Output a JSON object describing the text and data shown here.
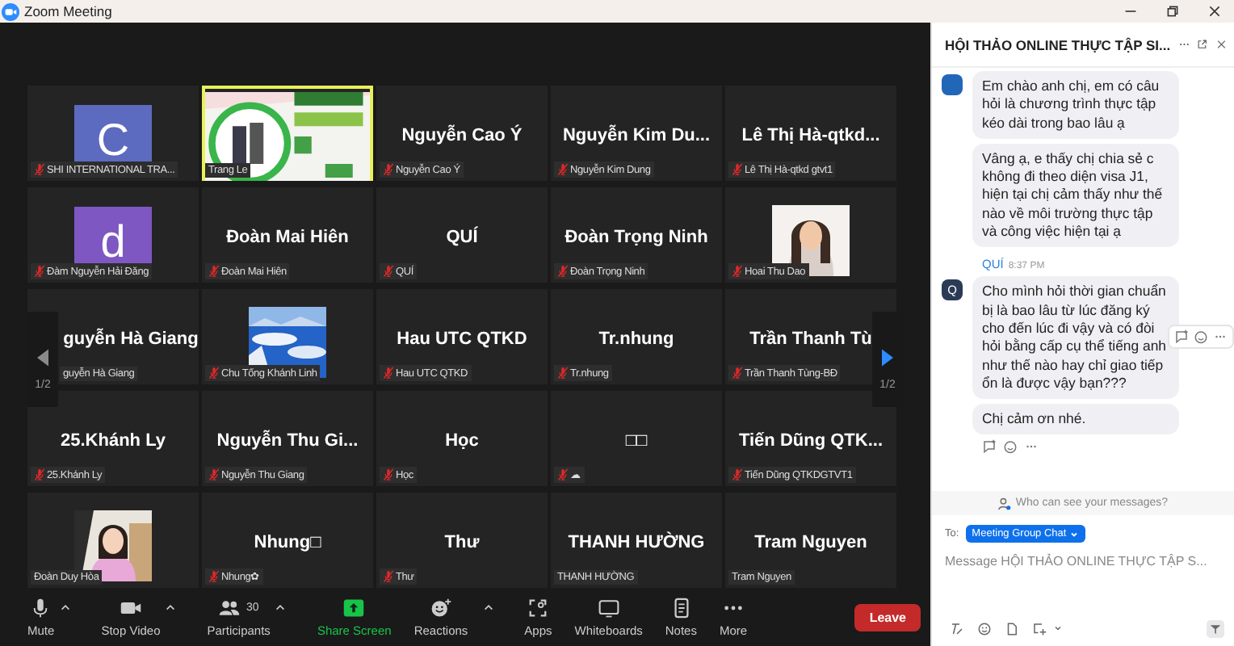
{
  "window": {
    "title": "Zoom Meeting"
  },
  "gallery": {
    "prev_page": "1/2",
    "next_page": "1/2",
    "prev_enabled": false,
    "next_enabled": true,
    "tiles": [
      {
        "kind": "letter",
        "letter": "C",
        "color": "#5c6bc0",
        "label": "SHI INTERNATIONAL TRA...",
        "muted": true,
        "speaking": false
      },
      {
        "kind": "picture",
        "label": "Trang Le",
        "muted": false,
        "speaking": true
      },
      {
        "kind": "name",
        "name": "Nguyễn Cao Ý",
        "label": "Nguyễn Cao Ý",
        "muted": true,
        "speaking": false
      },
      {
        "kind": "name",
        "name": "Nguyễn Kim Du...",
        "label": "Nguyễn Kim Dung",
        "muted": true,
        "speaking": false
      },
      {
        "kind": "name",
        "name": "Lê Thị Hà-qtkd...",
        "label": "Lê Thị Hà-qtkd gtvt1",
        "muted": true,
        "speaking": false
      },
      {
        "kind": "letter",
        "letter": "d",
        "color": "#7e57c2",
        "label": "Đàm Nguyễn Hải Đăng",
        "muted": true,
        "speaking": false
      },
      {
        "kind": "name",
        "name": "Đoàn Mai Hiên",
        "label": "Đoàn Mai Hiên",
        "muted": true,
        "speaking": false
      },
      {
        "kind": "name",
        "name": "QUÍ",
        "label": "QUÍ",
        "muted": true,
        "speaking": false
      },
      {
        "kind": "name",
        "name": "Đoàn Trọng Ninh",
        "label": "Đoàn Trọng Ninh",
        "muted": true,
        "speaking": false
      },
      {
        "kind": "picture",
        "label": "Hoai Thu Dao",
        "muted": true,
        "speaking": false
      },
      {
        "kind": "name",
        "name": "guyễn Hà Giang",
        "label": "guyễn Hà Giang",
        "muted": false,
        "speaking": false
      },
      {
        "kind": "picture",
        "label": "Chu Tống Khánh Linh",
        "muted": true,
        "speaking": false
      },
      {
        "kind": "name",
        "name": "Hau UTC QTKD",
        "label": "Hau UTC QTKD",
        "muted": true,
        "speaking": false
      },
      {
        "kind": "name",
        "name": "Tr.nhung",
        "label": "Tr.nhung",
        "muted": true,
        "speaking": false
      },
      {
        "kind": "name",
        "name": "Trần Thanh Tù",
        "label": "Trần Thanh Tùng-BĐ",
        "muted": true,
        "speaking": false
      },
      {
        "kind": "name",
        "name": "25.Khánh Ly",
        "label": "25.Khánh Ly",
        "muted": true,
        "speaking": false
      },
      {
        "kind": "name",
        "name": "Nguyễn Thu Gi...",
        "label": "Nguyễn Thu Giang",
        "muted": true,
        "speaking": false
      },
      {
        "kind": "name",
        "name": "Học",
        "label": "Học",
        "muted": true,
        "speaking": false
      },
      {
        "kind": "name",
        "name": "□□",
        "label": "☁",
        "muted": true,
        "speaking": false
      },
      {
        "kind": "name",
        "name": "Tiến Dũng QTK...",
        "label": "Tiến Dũng QTKDGTVT1",
        "muted": true,
        "speaking": false
      },
      {
        "kind": "picture",
        "label": "Đoàn Duy Hòa",
        "muted": false,
        "speaking": false
      },
      {
        "kind": "name",
        "name": "Nhung□",
        "label": "Nhung✿",
        "muted": true,
        "speaking": false
      },
      {
        "kind": "name",
        "name": "Thư",
        "label": "Thư",
        "muted": true,
        "speaking": false
      },
      {
        "kind": "name",
        "name": "THANH HƯỜNG",
        "label": "THANH HƯỜNG",
        "muted": false,
        "speaking": false
      },
      {
        "kind": "name",
        "name": "Tram Nguyen",
        "label": "Tram Nguyen",
        "muted": false,
        "speaking": false
      }
    ]
  },
  "toolbar": {
    "buttons": [
      {
        "kind": "mic",
        "label": "Mute",
        "caret": true
      },
      {
        "kind": "video",
        "label": "Stop Video",
        "caret": true
      },
      {
        "kind": "participants",
        "label": "Participants",
        "count": "30",
        "caret": true
      },
      {
        "kind": "share",
        "label": "Share Screen",
        "caret": false
      },
      {
        "kind": "reactions",
        "label": "Reactions",
        "caret": true
      },
      {
        "kind": "apps",
        "label": "Apps",
        "caret": false
      },
      {
        "kind": "whiteboards",
        "label": "Whiteboards",
        "caret": false
      },
      {
        "kind": "notes",
        "label": "Notes",
        "caret": false
      },
      {
        "kind": "more",
        "label": "More",
        "caret": false
      }
    ],
    "leave": "Leave"
  },
  "chat": {
    "title": "HỘI THẢO ONLINE THỰC TẬP SI...",
    "messages": [
      {
        "show_avatar": true,
        "text": "Em chào anh chị, em có câu hỏi là chương trình thực tập kéo dài trong bao lâu ạ",
        "hover_actions": false,
        "reaction_bar": false
      },
      {
        "show_avatar": false,
        "text": "Vâng ạ, e thấy chị chia sẻ c không đi theo diện visa J1, hiện tại chị cảm thấy như thế nào về môi trường thực tập và công việc hiện tại ạ",
        "hover_actions": false,
        "reaction_bar": false
      },
      {
        "show_avatar": true,
        "avatar_text": "Q",
        "sender": "QUÍ",
        "time": "8:37 PM",
        "text": "Cho mình hỏi thời gian chuẩn bị là bao lâu từ lúc đăng ký cho đến lúc đi vậy và có đòi hỏi bằng cấp cụ thể tiếng anh như thế nào hay chỉ giao tiếp ổn là được vậy bạn???",
        "hover_actions": true,
        "reaction_bar": false
      },
      {
        "show_avatar": false,
        "text": "Chị cảm ơn nhé.",
        "hover_actions": false,
        "reaction_bar": true
      }
    ],
    "privacy_note": "Who can see your messages?",
    "to_label": "To:",
    "recipient": "Meeting Group Chat",
    "placeholder": "Message HỘI THẢO ONLINE THỰC TẬP S..."
  }
}
